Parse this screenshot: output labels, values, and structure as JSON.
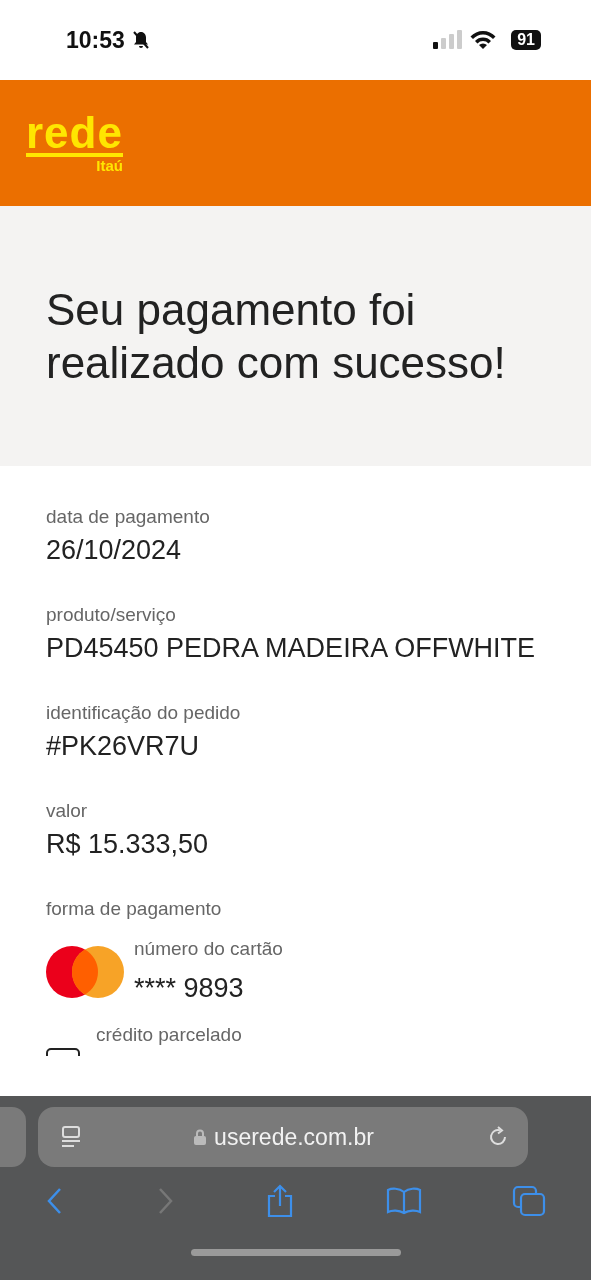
{
  "status_bar": {
    "time": "10:53",
    "battery": "91"
  },
  "header": {
    "logo": "rede",
    "logo_sub": "Itaú"
  },
  "hero": {
    "title": "Seu pagamento foi realizado com sucesso!"
  },
  "fields": [
    {
      "label": "data de pagamento",
      "value": "26/10/2024"
    },
    {
      "label": "produto/serviço",
      "value": "PD45450 PEDRA MADEIRA OFFWHITE"
    },
    {
      "label": "identificação do pedido",
      "value": "#PK26VR7U"
    },
    {
      "label": "valor",
      "value": "R$ 15.333,50"
    }
  ],
  "payment": {
    "label": "forma de pagamento",
    "card_label": "número do cartão",
    "card_number": "**** 9893",
    "installments_label": "crédito parcelado"
  },
  "browser": {
    "url": "userede.com.br",
    "nav": [
      {
        "kind": "back",
        "disabled": false
      },
      {
        "kind": "forward",
        "disabled": true
      },
      {
        "kind": "share",
        "disabled": false
      },
      {
        "kind": "bookmarks",
        "disabled": false
      },
      {
        "kind": "tabs",
        "disabled": false
      }
    ]
  }
}
